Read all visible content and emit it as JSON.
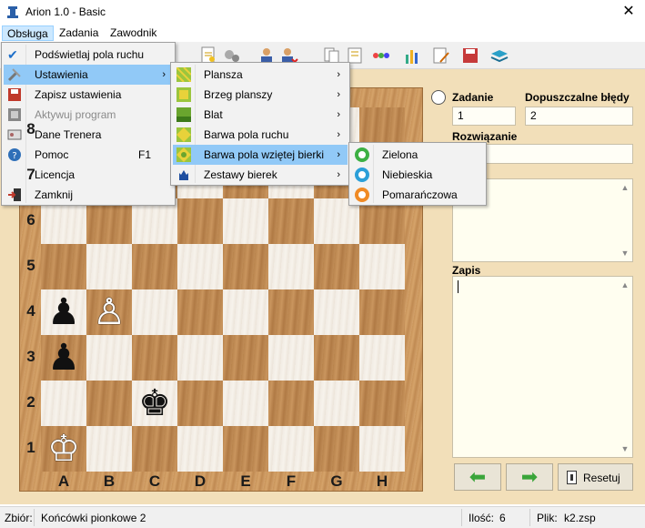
{
  "window": {
    "title": "Arion 1.0 - Basic",
    "close_glyph": "✕"
  },
  "menubar": {
    "items": [
      "Obsługa",
      "Zadania",
      "Zawodnik"
    ]
  },
  "menu_obsluga": {
    "items": [
      {
        "label": "Podświetlaj pola ruchu",
        "icon": "checkmark-icon"
      },
      {
        "label": "Ustawienia",
        "icon": "tools-icon",
        "submenu": "›"
      },
      {
        "label": "Zapisz ustawienia",
        "icon": "save-icon"
      },
      {
        "label": "Aktywuj program",
        "icon": "activate-icon",
        "disabled": true
      },
      {
        "label": "Dane Trenera",
        "icon": "trainer-card-icon"
      },
      {
        "label": "Pomoc",
        "icon": "help-icon",
        "shortcut": "F1"
      },
      {
        "label": "Licencja",
        "icon": ""
      },
      {
        "label": "Zamknij",
        "icon": "exit-icon"
      }
    ]
  },
  "menu_ustawienia": {
    "items": [
      {
        "label": "Plansza",
        "submenu": "›"
      },
      {
        "label": "Brzeg planszy",
        "submenu": "›"
      },
      {
        "label": "Blat",
        "submenu": "›"
      },
      {
        "label": "Barwa pola ruchu",
        "submenu": "›"
      },
      {
        "label": "Barwa pola wziętej bierki",
        "submenu": "›"
      },
      {
        "label": "Zestawy bierek",
        "submenu": "›"
      }
    ]
  },
  "menu_barwa": {
    "items": [
      {
        "label": "Zielona",
        "color": "#3cb043"
      },
      {
        "label": "Niebieskia",
        "color": "#2b9fd8"
      },
      {
        "label": "Pomarańczowa",
        "color": "#f08a24"
      }
    ]
  },
  "board": {
    "ranks": [
      "8",
      "7",
      "6",
      "5",
      "4",
      "3",
      "2",
      "1"
    ],
    "files": [
      "A",
      "B",
      "C",
      "D",
      "E",
      "F",
      "G",
      "H"
    ],
    "pieces": [
      {
        "square": "a4",
        "glyph": "♟",
        "color": "black"
      },
      {
        "square": "b4",
        "glyph": "♙",
        "color": "white"
      },
      {
        "square": "a3",
        "glyph": "♟",
        "color": "black"
      },
      {
        "square": "c2",
        "glyph": "♚",
        "color": "black"
      },
      {
        "square": "a1",
        "glyph": "♔",
        "color": "white"
      }
    ]
  },
  "panel": {
    "zadanie_label": "Zadanie",
    "zadanie_value": "1",
    "bledy_label": "Dopuszczalne błędy",
    "bledy_value": "2",
    "rozwiazanie_label": "Rozwiązanie",
    "zapis_label": "Zapis",
    "reset_label": "Resetuj"
  },
  "status": {
    "zbior_label": "Zbiór:",
    "zbior_value": "Końcówki pionkowe 2",
    "ilosc_label": "Ilość:",
    "ilosc_value": "6",
    "plik_label": "Plik:",
    "plik_value": "k2.zsp"
  }
}
